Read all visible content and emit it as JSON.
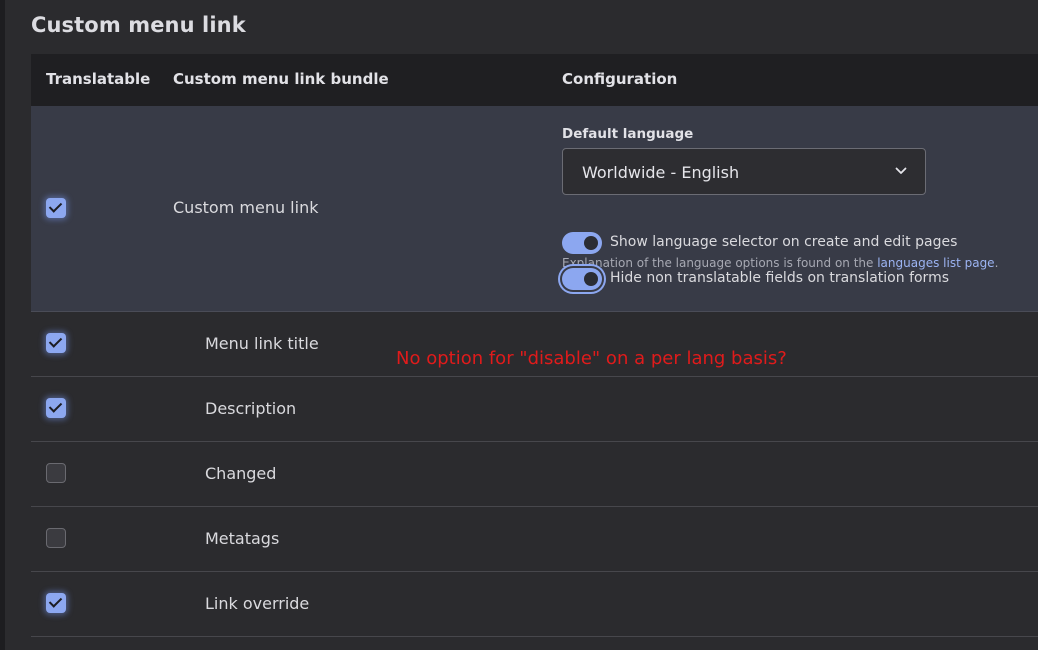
{
  "page": {
    "title": "Custom menu link"
  },
  "table": {
    "headers": {
      "translatable": "Translatable",
      "bundle": "Custom menu link bundle",
      "configuration": "Configuration"
    },
    "bundle_row": {
      "label": "Custom menu link",
      "checked": true,
      "default_language_label": "Default language",
      "default_language_value": "Worldwide - English",
      "help_text": "Explanation of the language options is found on the ",
      "help_link": "languages list page",
      "help_suffix": ".",
      "toggles": [
        {
          "label": "Show language selector on create and edit pages",
          "on": true
        },
        {
          "label": "Hide non translatable fields on translation forms",
          "on": true
        }
      ]
    },
    "fields": [
      {
        "label": "Menu link title",
        "checked": true
      },
      {
        "label": "Description",
        "checked": true
      },
      {
        "label": "Changed",
        "checked": false
      },
      {
        "label": "Metatags",
        "checked": false
      },
      {
        "label": "Link override",
        "checked": true
      }
    ]
  },
  "annotation": {
    "text": "No option for \"disable\" on a per lang basis?",
    "color": "#e01b1b"
  },
  "colors": {
    "accent": "#8ca7f0",
    "link": "#9cb4f3",
    "background": "#2b2b2e",
    "header_bg": "#1f1f22",
    "bundle_row_bg": "#383b47"
  },
  "icons": {
    "select_arrow": "chevron-down-icon",
    "checked": "checkmark-icon"
  }
}
